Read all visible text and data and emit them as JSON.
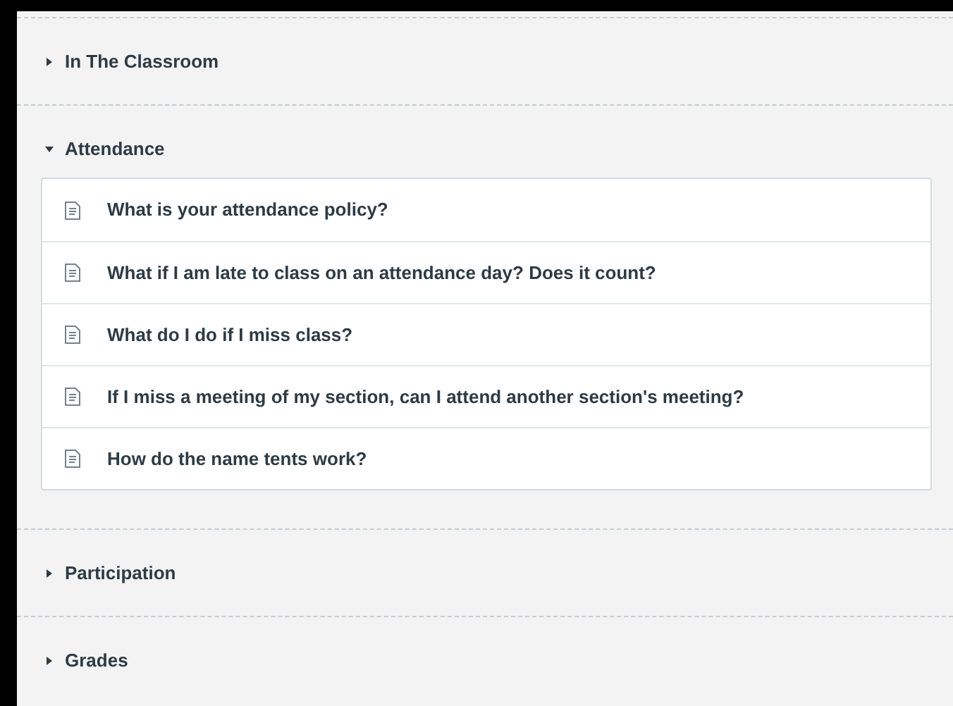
{
  "sections": [
    {
      "title": "In The Classroom",
      "expanded": false
    },
    {
      "title": "Attendance",
      "expanded": true,
      "items": [
        {
          "title": "What is your attendance policy?"
        },
        {
          "title": "What if I am late to class on an attendance day? Does it count?"
        },
        {
          "title": "What do I do if I miss class?"
        },
        {
          "title": "If I miss a meeting of my section, can I attend another section's meeting?"
        },
        {
          "title": "How do the name tents work?"
        }
      ]
    },
    {
      "title": "Participation",
      "expanded": false
    },
    {
      "title": "Grades",
      "expanded": false
    }
  ]
}
